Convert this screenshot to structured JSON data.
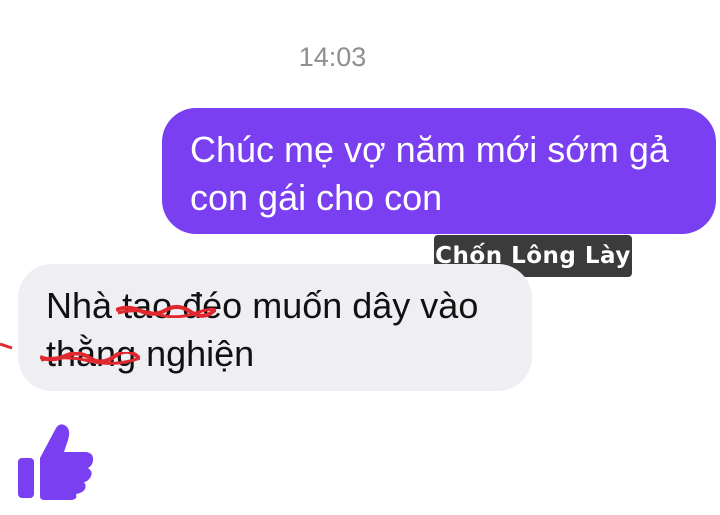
{
  "timestamp": "14:03",
  "outgoing_message": {
    "line1": "Chúc mẹ vợ năm mới sớm gả",
    "line2": "con gái cho con"
  },
  "watermark": "Chốn Lông Lày",
  "incoming_message": {
    "word1": "Nhà",
    "struck1": "tao đéo",
    "rest1": "muốn dây vào",
    "struck2": "thằng nghiện"
  },
  "colors": {
    "outgoing_bubble": "#7b3ff2",
    "incoming_bubble": "#efeff3",
    "scribble": "#e0282e",
    "like_icon": "#7b3ff2"
  },
  "icons": [
    "thumbs-up-icon"
  ]
}
